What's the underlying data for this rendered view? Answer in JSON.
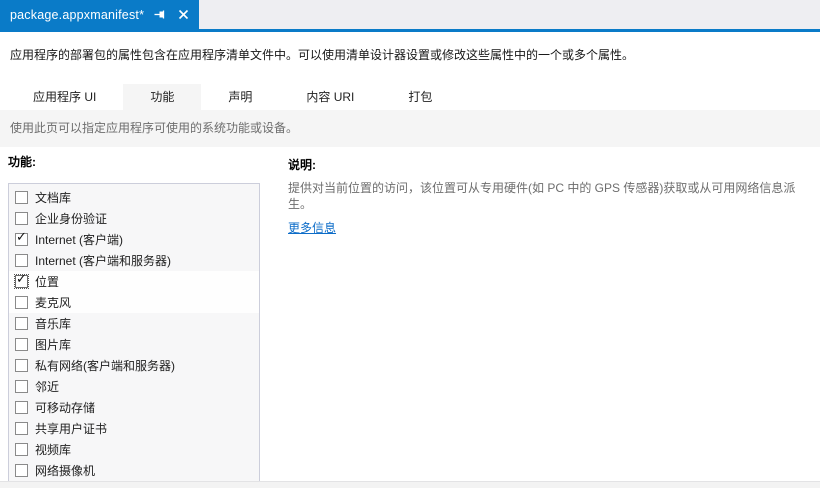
{
  "document_tab": {
    "title": "package.appxmanifest*",
    "pin_icon": "pin-icon",
    "close_icon": "✕"
  },
  "intro_text": "应用程序的部署包的属性包含在应用程序清单文件中。可以使用清单设计器设置或修改这些属性中的一个或多个属性。",
  "tabs": [
    {
      "label": "应用程序 UI",
      "active": false
    },
    {
      "label": "功能",
      "active": true
    },
    {
      "label": "声明",
      "active": false
    },
    {
      "label": "内容 URI",
      "active": false
    },
    {
      "label": "打包",
      "active": false
    }
  ],
  "page_hint": "使用此页可以指定应用程序可使用的系统功能或设备。",
  "capabilities": {
    "label": "功能:",
    "items": [
      {
        "label": "文档库",
        "checked": false,
        "highlighted": false,
        "focused": false
      },
      {
        "label": "企业身份验证",
        "checked": false,
        "highlighted": false,
        "focused": false
      },
      {
        "label": "Internet (客户端)",
        "checked": true,
        "highlighted": false,
        "focused": false
      },
      {
        "label": "Internet (客户端和服务器)",
        "checked": false,
        "highlighted": false,
        "focused": false
      },
      {
        "label": "位置",
        "checked": true,
        "highlighted": true,
        "focused": true
      },
      {
        "label": "麦克风",
        "checked": false,
        "highlighted": true,
        "focused": false
      },
      {
        "label": "音乐库",
        "checked": false,
        "highlighted": false,
        "focused": false
      },
      {
        "label": "图片库",
        "checked": false,
        "highlighted": false,
        "focused": false
      },
      {
        "label": "私有网络(客户端和服务器)",
        "checked": false,
        "highlighted": false,
        "focused": false
      },
      {
        "label": "邻近",
        "checked": false,
        "highlighted": false,
        "focused": false
      },
      {
        "label": "可移动存储",
        "checked": false,
        "highlighted": false,
        "focused": false
      },
      {
        "label": "共享用户证书",
        "checked": false,
        "highlighted": false,
        "focused": false
      },
      {
        "label": "视频库",
        "checked": false,
        "highlighted": false,
        "focused": false
      },
      {
        "label": "网络摄像机",
        "checked": false,
        "highlighted": false,
        "focused": false
      }
    ]
  },
  "description": {
    "title": "说明:",
    "text": "提供对当前位置的访问，该位置可从专用硬件(如 PC 中的 GPS 传感器)获取或从可用网络信息派生。",
    "link": "更多信息"
  },
  "colors": {
    "accent": "#0a7bc8",
    "link": "#0c6cc8",
    "tab_active_bg": "#f5f5f5"
  }
}
